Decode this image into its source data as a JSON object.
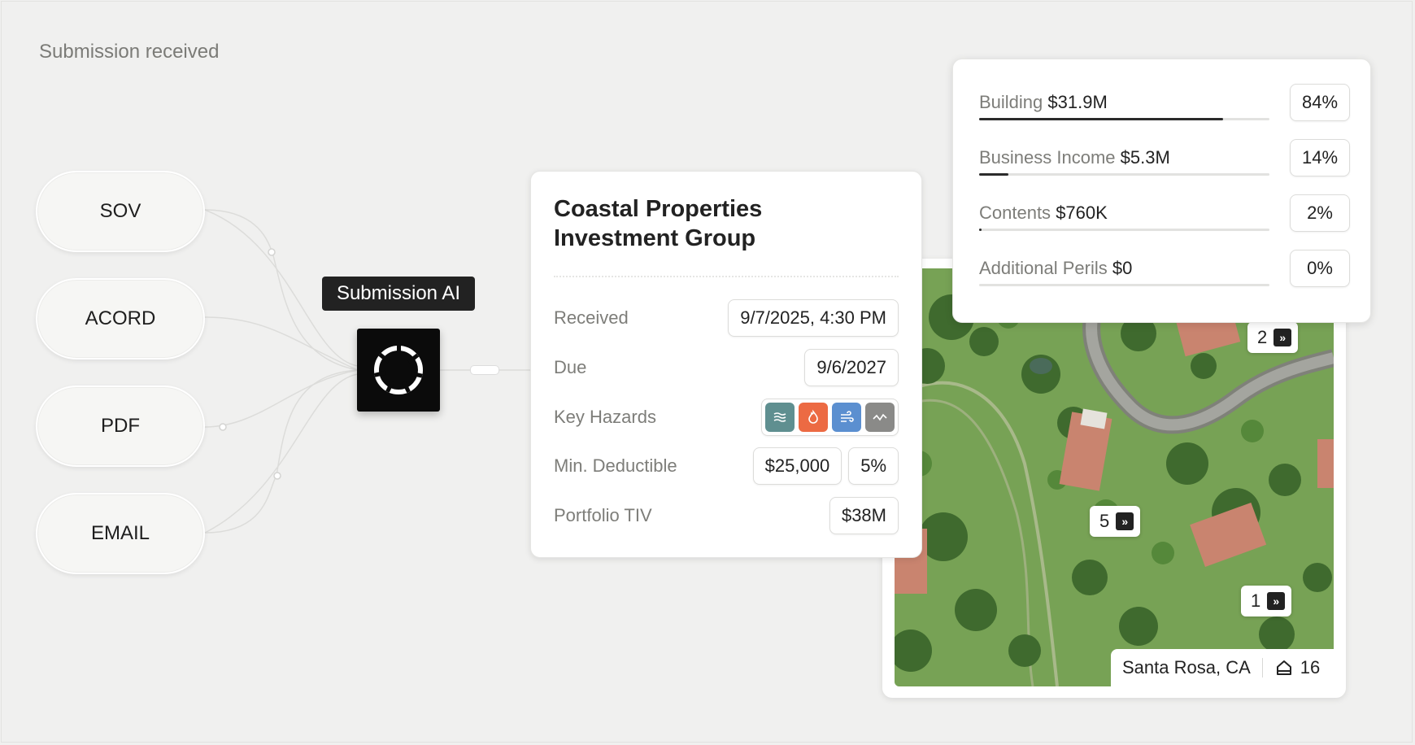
{
  "header": {
    "title": "Submission received"
  },
  "sources": [
    "SOV",
    "ACORD",
    "PDF",
    "EMAIL"
  ],
  "ai": {
    "label": "Submission AI",
    "logo_icon": "aperture-icon"
  },
  "summary": {
    "company": "Coastal Properties Investment Group",
    "received_label": "Received",
    "received_value": "9/7/2025, 4:30 PM",
    "due_label": "Due",
    "due_value": "9/6/2027",
    "hazards_label": "Key Hazards",
    "hazards": [
      {
        "icon": "flood-icon",
        "color": "#5f8f90"
      },
      {
        "icon": "fire-icon",
        "color": "#ec6a43"
      },
      {
        "icon": "wind-icon",
        "color": "#5b8fd0"
      },
      {
        "icon": "earthquake-icon",
        "color": "#8a8a88"
      }
    ],
    "deductible_label": "Min. Deductible",
    "deductible_amount": "$25,000",
    "deductible_pct": "5%",
    "tiv_label": "Portfolio TIV",
    "tiv_value": "$38M"
  },
  "coverage": [
    {
      "label": "Building",
      "amount": "$31.9M",
      "pct": "84%",
      "share": 0.84
    },
    {
      "label": "Business Income",
      "amount": "$5.3M",
      "pct": "14%",
      "share": 0.1
    },
    {
      "label": "Contents",
      "amount": "$760K",
      "pct": "2%",
      "share": 0.01
    },
    {
      "label": "Additional Perils",
      "amount": "$0",
      "pct": "0%",
      "share": 0
    }
  ],
  "map": {
    "markers": [
      "2",
      "5",
      "1"
    ],
    "location": "Santa Rosa, CA",
    "property_count": "16",
    "home_icon": "home-icon"
  }
}
